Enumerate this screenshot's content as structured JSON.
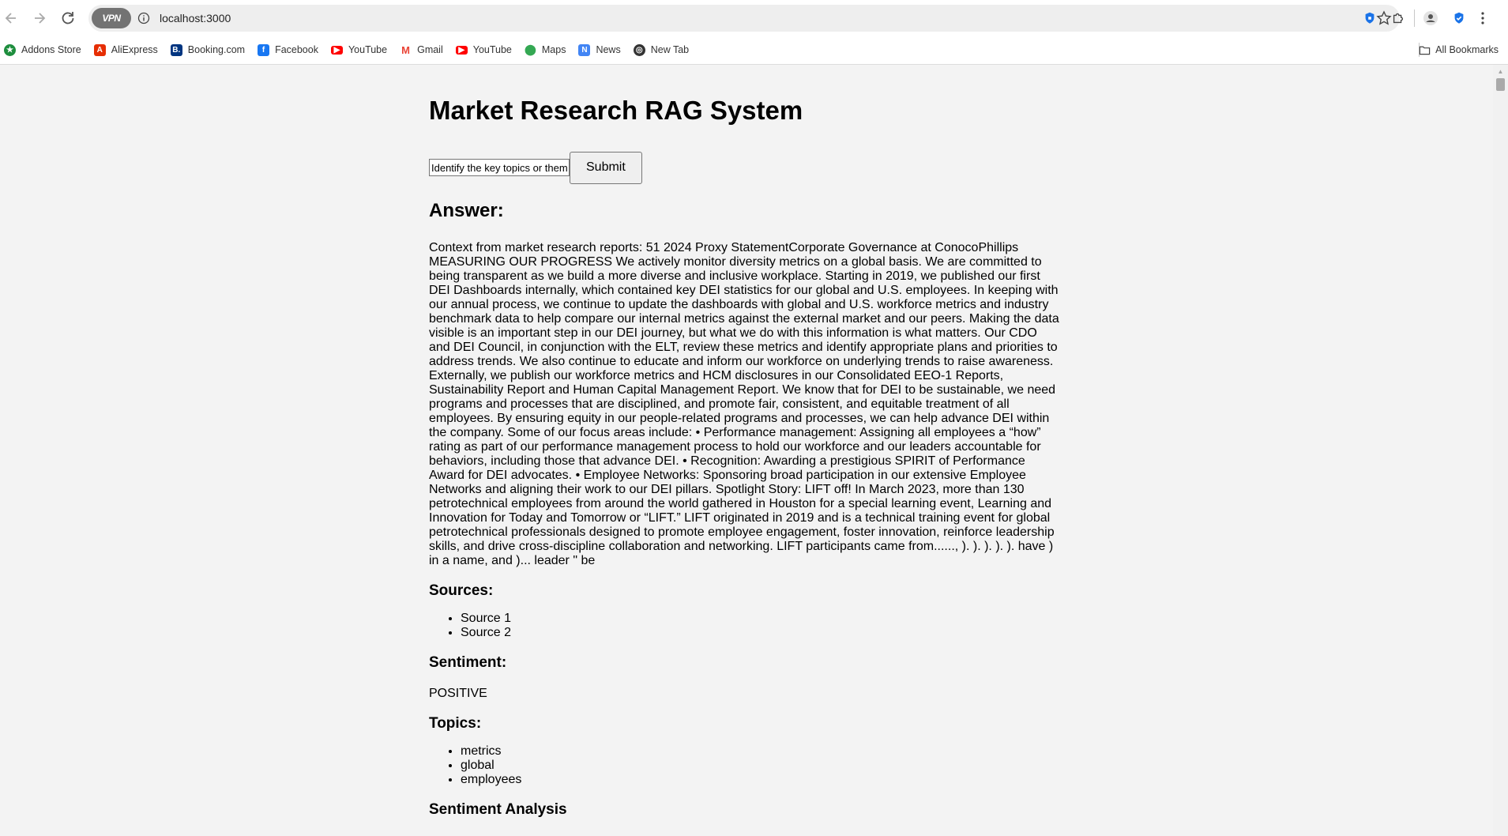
{
  "browser": {
    "url": "localhost:3000",
    "vpn_label": "VPN",
    "bookmarks": [
      {
        "label": "Addons Store",
        "color": "#1e8e3e"
      },
      {
        "label": "AliExpress",
        "color": "#e62e04"
      },
      {
        "label": "Booking.com",
        "color": "#003580"
      },
      {
        "label": "Facebook",
        "color": "#1877f2"
      },
      {
        "label": "YouTube",
        "color": "#ff0000"
      },
      {
        "label": "Gmail",
        "color": "#ea4335"
      },
      {
        "label": "YouTube",
        "color": "#ff0000"
      },
      {
        "label": "Maps",
        "color": "#34a853"
      },
      {
        "label": "News",
        "color": "#4285f4"
      },
      {
        "label": "New Tab",
        "color": "#333333"
      }
    ],
    "all_bookmarks": "All Bookmarks"
  },
  "page": {
    "title": "Market Research RAG System",
    "query_value": "Identify the key topics or themes",
    "submit_label": "Submit",
    "answer_heading": "Answer:",
    "answer_text": "Context from market research reports: 51 2024 Proxy StatementCorporate Governance at ConocoPhillips MEASURING OUR PROGRESS We actively monitor diversity metrics on a global basis. We are committed to being transparent as we build a more diverse and inclusive workplace. Starting in 2019, we published our first DEI Dashboards internally, which contained key DEI statistics for our global and U.S. employees. In keeping with our annual process, we continue to update the dashboards with global and U.S. workforce metrics and industry benchmark data to help compare our internal metrics against the external market and our peers. Making the data visible is an important step in our DEI journey, but what we do with this information is what matters. Our CDO and DEI Council, in conjunction with the ELT, review these metrics and identify appropriate plans and priorities to address trends. We also continue to educate and inform our workforce on underlying trends to raise awareness. Externally, we publish our workforce metrics and HCM disclosures in our Consolidated EEO-1 Reports, Sustainability Report and Human Capital Management Report. We know that for DEI to be sustainable, we need programs and processes that are disciplined, and promote fair, consistent, and equitable treatment of all employees. By ensuring equity in our people-related programs and processes, we can help advance DEI within the company. Some of our focus areas include: • Performance management: Assigning all employees a “how” rating as part of our performance management process to hold our workforce and our leaders accountable for behaviors, including those that advance DEI. • Recognition: Awarding a prestigious SPIRIT of Performance Award for DEI advocates. • Employee Networks: Sponsoring broad participation in our extensive Employee Networks and aligning their work to our DEI pillars. Spotlight Story: LIFT off! In March 2023, more than 130 petrotechnical employees from around the world gathered in Houston for a special learning event, Learning and Innovation for Today and Tomorrow or “LIFT.” LIFT originated in 2019 and is a technical training event for global petrotechnical professionals designed to promote employee engagement, foster innovation, reinforce leadership skills, and drive cross-discipline collaboration and networking. LIFT participants came from......, ). ). ). ). ). have ) in a name, and )... leader \" be",
    "sources_heading": "Sources:",
    "sources": [
      "Source 1",
      "Source 2"
    ],
    "sentiment_heading": "Sentiment:",
    "sentiment_value": "POSITIVE",
    "topics_heading": "Topics:",
    "topics": [
      "metrics",
      "global",
      "employees"
    ],
    "sentiment_analysis_heading": "Sentiment Analysis"
  }
}
